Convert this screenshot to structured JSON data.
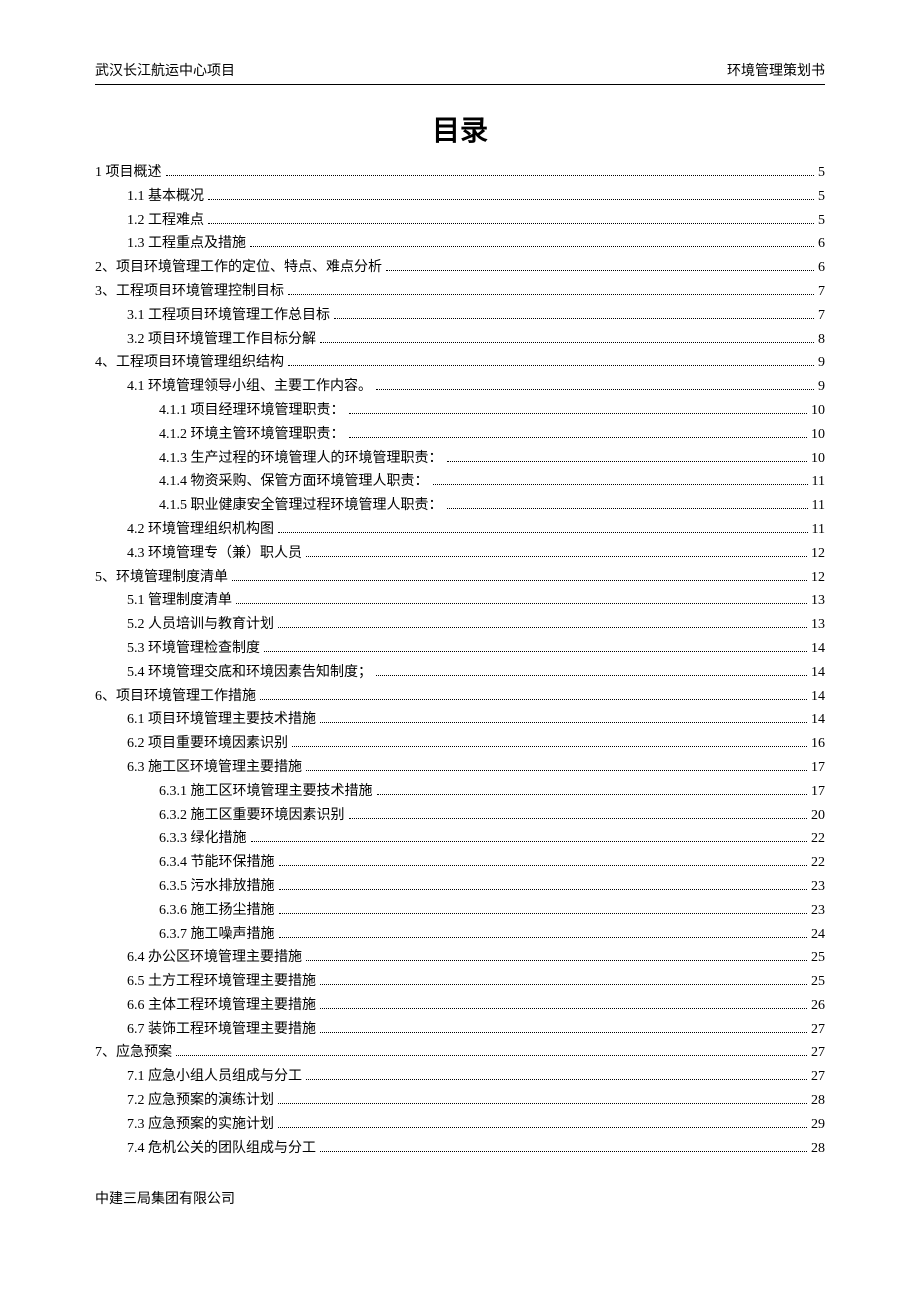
{
  "header": {
    "left": "武汉长江航运中心项目",
    "right": "环境管理策划书"
  },
  "title": "目录",
  "toc": [
    {
      "level": 1,
      "label": "1 项目概述",
      "page": "5"
    },
    {
      "level": 2,
      "label": "1.1  基本概况",
      "page": "5"
    },
    {
      "level": 2,
      "label": "1.2  工程难点",
      "page": "5"
    },
    {
      "level": 2,
      "label": "1.3  工程重点及措施",
      "page": "6"
    },
    {
      "level": 1,
      "label": "2、项目环境管理工作的定位、特点、难点分析",
      "page": "6"
    },
    {
      "level": 1,
      "label": "3、工程项目环境管理控制目标",
      "page": "7"
    },
    {
      "level": 2,
      "label": "3.1 工程项目环境管理工作总目标",
      "page": "7"
    },
    {
      "level": 2,
      "label": "3.2 项目环境管理工作目标分解",
      "page": "8"
    },
    {
      "level": 1,
      "label": "4、工程项目环境管理组织结构",
      "page": "9"
    },
    {
      "level": 2,
      "label": "4.1 环境管理领导小组、主要工作内容。",
      "page": "9"
    },
    {
      "level": 3,
      "label": "4.1.1 项目经理环境管理职责：",
      "page": "10"
    },
    {
      "level": 3,
      "label": "4.1.2 环境主管环境管理职责：",
      "page": "10"
    },
    {
      "level": 3,
      "label": "4.1.3 生产过程的环境管理人的环境管理职责：",
      "page": "10"
    },
    {
      "level": 3,
      "label": "4.1.4 物资采购、保管方面环境管理人职责：",
      "page": "11"
    },
    {
      "level": 3,
      "label": "4.1.5 职业健康安全管理过程环境管理人职责：",
      "page": "11"
    },
    {
      "level": 2,
      "label": "4.2 环境管理组织机构图",
      "page": "11"
    },
    {
      "level": 2,
      "label": "4.3 环境管理专（兼）职人员",
      "page": "12"
    },
    {
      "level": 1,
      "label": "5、环境管理制度清单",
      "page": "12"
    },
    {
      "level": 2,
      "label": "5.1  管理制度清单",
      "page": "13"
    },
    {
      "level": 2,
      "label": "5.2  人员培训与教育计划",
      "page": "13"
    },
    {
      "level": 2,
      "label": "5.3  环境管理检查制度",
      "page": "14"
    },
    {
      "level": 2,
      "label": "5.4 环境管理交底和环境因素告知制度；",
      "page": "14"
    },
    {
      "level": 1,
      "label": "6、项目环境管理工作措施",
      "page": "14"
    },
    {
      "level": 2,
      "label": "6.1 项目环境管理主要技术措施",
      "page": "14"
    },
    {
      "level": 2,
      "label": "6.2  项目重要环境因素识别",
      "page": "16"
    },
    {
      "level": 2,
      "label": "6.3  施工区环境管理主要措施",
      "page": "17"
    },
    {
      "level": 3,
      "label": "6.3.1 施工区环境管理主要技术措施",
      "page": "17"
    },
    {
      "level": 3,
      "label": "6.3.2 施工区重要环境因素识别",
      "page": "20"
    },
    {
      "level": 3,
      "label": "6.3.3  绿化措施",
      "page": "22"
    },
    {
      "level": 3,
      "label": "6.3.4  节能环保措施",
      "page": "22"
    },
    {
      "level": 3,
      "label": "6.3.5  污水排放措施",
      "page": "23"
    },
    {
      "level": 3,
      "label": "6.3.6  施工扬尘措施",
      "page": "23"
    },
    {
      "level": 3,
      "label": "6.3.7  施工噪声措施",
      "page": "24"
    },
    {
      "level": 2,
      "label": "6.4  办公区环境管理主要措施",
      "page": "25"
    },
    {
      "level": 2,
      "label": "6.5  土方工程环境管理主要措施",
      "page": "25"
    },
    {
      "level": 2,
      "label": "6.6  主体工程环境管理主要措施",
      "page": "26"
    },
    {
      "level": 2,
      "label": "6.7  装饰工程环境管理主要措施",
      "page": "27"
    },
    {
      "level": 1,
      "label": "7、应急预案",
      "page": "27"
    },
    {
      "level": 2,
      "label": "7.1  应急小组人员组成与分工",
      "page": "27"
    },
    {
      "level": 2,
      "label": "7.2  应急预案的演练计划",
      "page": "28"
    },
    {
      "level": 2,
      "label": "7.3  应急预案的实施计划",
      "page": "29"
    },
    {
      "level": 2,
      "label": "7.4  危机公关的团队组成与分工",
      "page": "28"
    }
  ],
  "footer": "中建三局集团有限公司"
}
